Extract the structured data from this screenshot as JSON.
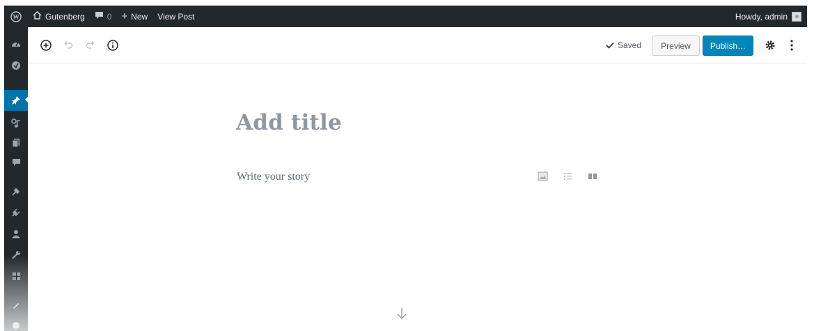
{
  "adminbar": {
    "site_name": "Gutenberg",
    "comments_count": "0",
    "new_label": "New",
    "view_post_label": "View Post",
    "greeting": "Howdy, admin"
  },
  "sidebar": {
    "items": [
      {
        "icon": "dashboard-icon"
      },
      {
        "icon": "gutenberg-icon"
      },
      {
        "icon": "pin-icon",
        "active": true
      },
      {
        "icon": "media-icon"
      },
      {
        "icon": "pages-icon"
      },
      {
        "icon": "comments-icon"
      },
      {
        "icon": "appearance-icon"
      },
      {
        "icon": "plugins-icon"
      },
      {
        "icon": "users-icon"
      },
      {
        "icon": "tools-icon"
      },
      {
        "icon": "settings-icon"
      },
      {
        "icon": "pencil-icon"
      },
      {
        "icon": "collapse-icon"
      }
    ]
  },
  "header": {
    "saved_label": "Saved",
    "preview_label": "Preview",
    "publish_label": "Publish…"
  },
  "editor": {
    "title_placeholder": "Add title",
    "story_placeholder": "Write your story"
  },
  "colors": {
    "admin_bar": "#23282d",
    "accent": "#0073aa",
    "publish": "#0085ba"
  }
}
